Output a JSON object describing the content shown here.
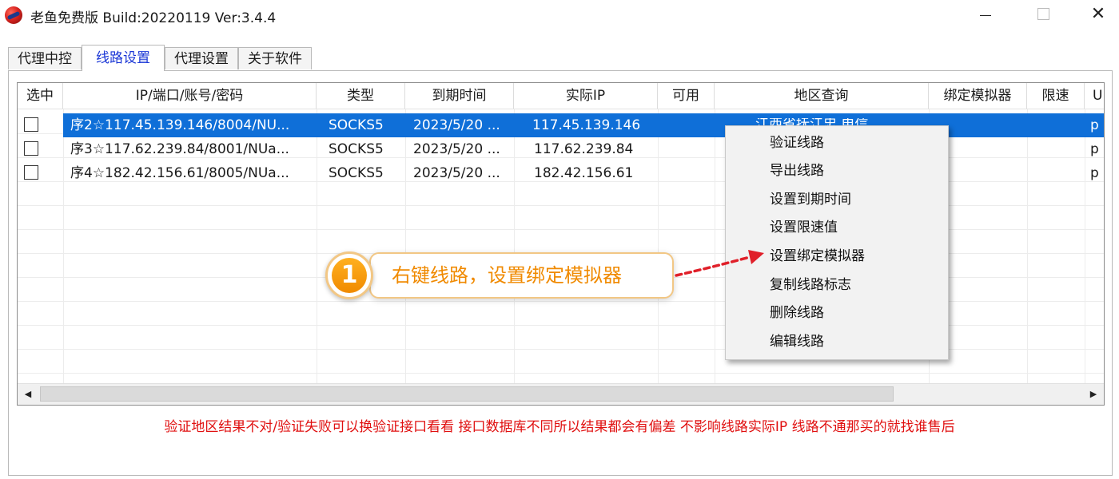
{
  "window": {
    "title": "老鱼免费版 Build:20220119 Ver:3.4.4",
    "close_glyph": "✕"
  },
  "tabs": [
    {
      "label": "代理中控"
    },
    {
      "label": "线路设置",
      "active": true
    },
    {
      "label": "代理设置"
    },
    {
      "label": "关于软件"
    }
  ],
  "table": {
    "columns": [
      "选中",
      "IP/端口/账号/密码",
      "类型",
      "到期时间",
      "实际IP",
      "可用",
      "地区查询",
      "绑定模拟器",
      "限速",
      "U"
    ],
    "rows": [
      {
        "checked": false,
        "selected": true,
        "ip": "序2☆117.45.139.146/8004/NU...",
        "type": "SOCKS5",
        "expire": "2023/5/20 ...",
        "real_ip": "117.45.139.146",
        "available": "",
        "region": "江西省抚江忠 电信",
        "bind": "",
        "limit": "",
        "u": "p"
      },
      {
        "checked": false,
        "selected": false,
        "ip": "序3☆117.62.239.84/8001/NUa...",
        "type": "SOCKS5",
        "expire": "2023/5/20 ...",
        "real_ip": "117.62.239.84",
        "available": "",
        "region": "",
        "bind": "",
        "limit": "",
        "u": "p"
      },
      {
        "checked": false,
        "selected": false,
        "ip": "序4☆182.42.156.61/8005/NUa...",
        "type": "SOCKS5",
        "expire": "2023/5/20 ...",
        "real_ip": "182.42.156.61",
        "available": "",
        "region": "",
        "bind": "",
        "limit": "",
        "u": "p"
      }
    ]
  },
  "scrollbar": {
    "left_glyph": "◀",
    "right_glyph": "▶"
  },
  "context_menu": {
    "items": [
      "验证线路",
      "导出线路",
      "设置到期时间",
      "设置限速值",
      "设置绑定模拟器",
      "复制线路标志",
      "删除线路",
      "编辑线路"
    ]
  },
  "callout": {
    "number": "1",
    "text": "右键线路，设置绑定模拟器",
    "color": "#f08a00",
    "arrow_color": "#e0202a"
  },
  "footer_note": "验证地区结果不对/验证失败可以换验证接口看看 接口数据库不同所以结果都会有偏差 不影响线路实际IP 线路不通那买的就找谁售后",
  "colors": {
    "selection": "#0f6fd8",
    "active_tab_text": "#1a36d6",
    "footer_text": "#e01010"
  }
}
